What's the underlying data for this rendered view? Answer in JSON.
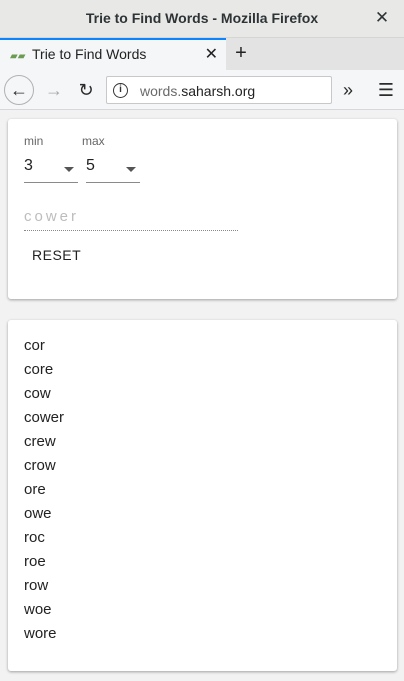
{
  "window": {
    "title": "Trie to Find Words - Mozilla Firefox",
    "close_glyph": "✕"
  },
  "tab": {
    "title": "Trie to Find Words",
    "close_glyph": "✕",
    "favicon": "app-favicon"
  },
  "newtab_glyph": "+",
  "nav": {
    "back_glyph": "←",
    "forward_glyph": "→",
    "reload_glyph": "↻",
    "info_glyph": "i",
    "url_prefix": "words.",
    "url_host": "saharsh.org",
    "overflow_glyph": "»",
    "menu_glyph": "☰"
  },
  "controls": {
    "min_label": "min",
    "min_value": "3",
    "max_label": "max",
    "max_value": "5",
    "letters_placeholder": "cower",
    "reset_label": "RESET"
  },
  "results": [
    "cor",
    "core",
    "cow",
    "cower",
    "crew",
    "crow",
    "ore",
    "owe",
    "roc",
    "roe",
    "row",
    "woe",
    "wore"
  ]
}
